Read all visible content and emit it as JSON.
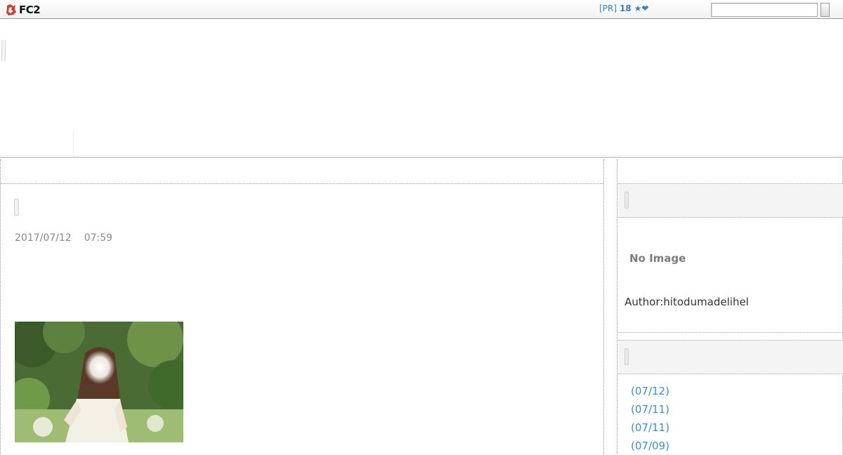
{
  "topbar": {
    "logo_text": "FC2",
    "pr_label": "[PR]",
    "pr_count": "18",
    "pr_icons": "★❤",
    "search_placeholder": ""
  },
  "entry": {
    "date": "2017/07/12",
    "time": "07:59"
  },
  "sidebar": {
    "profile": {
      "no_image_text": "No Image",
      "author": "Author:hitodumadelihel"
    },
    "recent_entries": [
      "(07/12)",
      "(07/11)",
      "(07/11)",
      "(07/09)"
    ]
  },
  "colors": {
    "link": "#3a8fd0",
    "pr_link": "#3a7fc1",
    "muted_text": "#8a8a8a"
  }
}
